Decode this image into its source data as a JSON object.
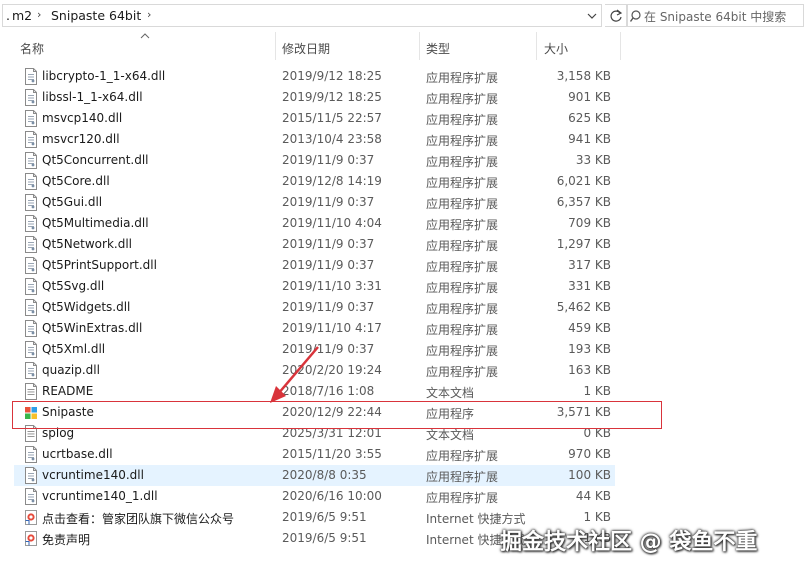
{
  "breadcrumb": [
    "m2",
    "Snipaste 64bit"
  ],
  "breadcrumb_prefix": ".",
  "search": {
    "placeholder": "在 Snipaste 64bit 中搜索"
  },
  "columns": {
    "name": "名称",
    "date": "修改日期",
    "type": "类型",
    "size": "大小"
  },
  "files": [
    {
      "name": "libcrypto-1_1-x64.dll",
      "date": "2019/9/12 18:25",
      "type": "应用程序扩展",
      "size": "3,158 KB",
      "icon": "dll-file-icon"
    },
    {
      "name": "libssl-1_1-x64.dll",
      "date": "2019/9/12 18:25",
      "type": "应用程序扩展",
      "size": "901 KB",
      "icon": "dll-file-icon"
    },
    {
      "name": "msvcp140.dll",
      "date": "2015/11/5 22:57",
      "type": "应用程序扩展",
      "size": "625 KB",
      "icon": "dll-file-icon"
    },
    {
      "name": "msvcr120.dll",
      "date": "2013/10/4 23:58",
      "type": "应用程序扩展",
      "size": "941 KB",
      "icon": "dll-file-icon"
    },
    {
      "name": "Qt5Concurrent.dll",
      "date": "2019/11/9 0:37",
      "type": "应用程序扩展",
      "size": "33 KB",
      "icon": "dll-file-icon"
    },
    {
      "name": "Qt5Core.dll",
      "date": "2019/12/8 14:19",
      "type": "应用程序扩展",
      "size": "6,021 KB",
      "icon": "dll-file-icon"
    },
    {
      "name": "Qt5Gui.dll",
      "date": "2019/11/9 0:37",
      "type": "应用程序扩展",
      "size": "6,357 KB",
      "icon": "dll-file-icon"
    },
    {
      "name": "Qt5Multimedia.dll",
      "date": "2019/11/10 4:04",
      "type": "应用程序扩展",
      "size": "709 KB",
      "icon": "dll-file-icon"
    },
    {
      "name": "Qt5Network.dll",
      "date": "2019/11/9 0:37",
      "type": "应用程序扩展",
      "size": "1,297 KB",
      "icon": "dll-file-icon"
    },
    {
      "name": "Qt5PrintSupport.dll",
      "date": "2019/11/9 0:37",
      "type": "应用程序扩展",
      "size": "317 KB",
      "icon": "dll-file-icon"
    },
    {
      "name": "Qt5Svg.dll",
      "date": "2019/11/10 3:31",
      "type": "应用程序扩展",
      "size": "331 KB",
      "icon": "dll-file-icon"
    },
    {
      "name": "Qt5Widgets.dll",
      "date": "2019/11/9 0:37",
      "type": "应用程序扩展",
      "size": "5,462 KB",
      "icon": "dll-file-icon"
    },
    {
      "name": "Qt5WinExtras.dll",
      "date": "2019/11/10 4:17",
      "type": "应用程序扩展",
      "size": "459 KB",
      "icon": "dll-file-icon"
    },
    {
      "name": "Qt5Xml.dll",
      "date": "2019/11/9 0:37",
      "type": "应用程序扩展",
      "size": "193 KB",
      "icon": "dll-file-icon"
    },
    {
      "name": "quazip.dll",
      "date": "2020/2/20 19:24",
      "type": "应用程序扩展",
      "size": "163 KB",
      "icon": "dll-file-icon"
    },
    {
      "name": "README",
      "date": "2018/7/16 1:08",
      "type": "文本文档",
      "size": "1 KB",
      "icon": "text-file-icon"
    },
    {
      "name": "Snipaste",
      "date": "2020/12/9 22:44",
      "type": "应用程序",
      "size": "3,571 KB",
      "icon": "snipaste-app-icon"
    },
    {
      "name": "splog",
      "date": "2025/3/31 12:01",
      "type": "文本文档",
      "size": "0 KB",
      "icon": "text-file-icon"
    },
    {
      "name": "ucrtbase.dll",
      "date": "2015/11/20 3:55",
      "type": "应用程序扩展",
      "size": "970 KB",
      "icon": "dll-file-icon"
    },
    {
      "name": "vcruntime140.dll",
      "date": "2020/8/8 0:35",
      "type": "应用程序扩展",
      "size": "100 KB",
      "icon": "dll-file-icon"
    },
    {
      "name": "vcruntime140_1.dll",
      "date": "2020/6/16 10:00",
      "type": "应用程序扩展",
      "size": "44 KB",
      "icon": "dll-file-icon"
    },
    {
      "name": "点击查看：管家团队旗下微信公众号",
      "date": "2019/6/5 9:51",
      "type": "Internet 快捷方式",
      "size": "1 KB",
      "icon": "internet-shortcut-icon"
    },
    {
      "name": "免责声明",
      "date": "2019/6/5 9:51",
      "type": "Internet 快捷方式",
      "size": "1 KB",
      "icon": "internet-shortcut-icon"
    }
  ],
  "selected_index": 19,
  "highlighted_index": 16,
  "watermark": "掘金技术社区 @ 袋鱼不重",
  "colors": {
    "highlight_border": "#d9343b",
    "arrow": "#d9343b",
    "selection_bg": "#e5f3ff"
  }
}
